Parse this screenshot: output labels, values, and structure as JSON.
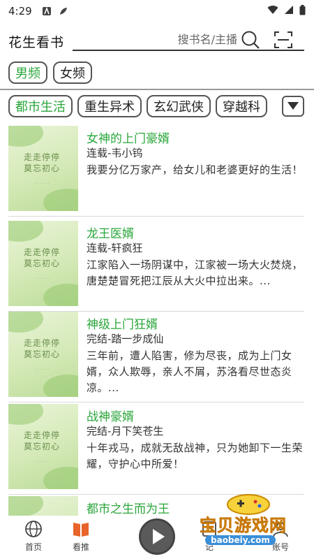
{
  "status_bar": {
    "time": "4:29"
  },
  "header": {
    "app_title": "花生看书",
    "search_placeholder": "搜书名/主播"
  },
  "gender_tabs": [
    {
      "label": "男频",
      "active": true
    },
    {
      "label": "女频",
      "active": false
    }
  ],
  "categories": [
    {
      "label": "都市生活",
      "active": true
    },
    {
      "label": "重生异术",
      "active": false
    },
    {
      "label": "玄幻武侠",
      "active": false
    },
    {
      "label": "穿越科",
      "active": false
    }
  ],
  "books": [
    {
      "title": "女神的上门豪婿",
      "author": "连载-韦小钨",
      "desc": "我要分亿万家产，给女儿和老婆更好的生活！"
    },
    {
      "title": "龙王医婿",
      "author": "连载-轩疯狂",
      "desc": "江家陷入一场阴谋中，江家被一场大火焚烧，唐楚楚冒死把江辰从大火中拉出来。..."
    },
    {
      "title": "神级上门狂婿",
      "author": "完结-踏一步成仙",
      "desc": "三年前，遭人陷害，修为尽丧，成为上门女婿，众人欺辱，亲人不屑，苏洛看尽世态炎凉。..."
    },
    {
      "title": "战神豪婿",
      "author": "完结-月下笑苍生",
      "desc": "十年戎马，成就无敌战神，只为她卸下一生荣耀，守护心中所爱！"
    },
    {
      "title": "都市之生而为王",
      "author": "",
      "desc": ""
    }
  ],
  "bottom_nav": [
    {
      "label": "首页",
      "icon": "globe-icon"
    },
    {
      "label": "看推",
      "icon": "book-open-icon"
    },
    {
      "label": "",
      "icon": "play-icon"
    },
    {
      "label": "记",
      "icon": "record-icon"
    },
    {
      "label": "账号",
      "icon": "account-icon"
    }
  ],
  "colors": {
    "accent": "#2aa63b",
    "text": "#333333",
    "play": "#5a5a5a"
  },
  "watermark": {
    "text": "宝贝游戏网",
    "url": "baobeiy.com"
  }
}
